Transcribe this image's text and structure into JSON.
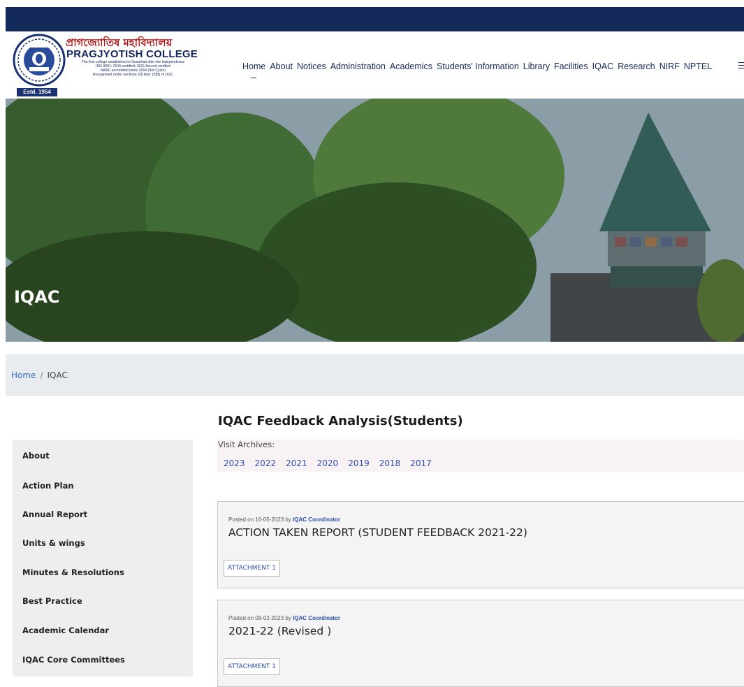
{
  "header": {
    "logo": {
      "bengali_name": "প্রাগজ্যোতিষ মহাবিদ্যালয়",
      "english_name": "PRAGJYOTISH COLLEGE",
      "tagline_lines": [
        "The first college established in Guwahati after the independence",
        "ISO 9001: 2015 certified; SDG Accord certified",
        "NAAC accredited since 2004 (3rd Cycle)",
        "Recognised under sections 2(f) And 12(B) of UGC"
      ],
      "estd": "Estd. 1954"
    },
    "nav": [
      "Home",
      "About",
      "Notices",
      "Administration",
      "Academics",
      "Students' Information",
      "Library",
      "Facilities",
      "IQAC",
      "Research",
      "NIRF",
      "NPTEL"
    ],
    "nav_extra_mark": "_",
    "menu_icon": "hamburger-icon",
    "brand_color": "#13295a"
  },
  "hero": {
    "title": "IQAC"
  },
  "breadcrumb": {
    "home": "Home",
    "separator": "/",
    "current": "IQAC"
  },
  "sidebar": {
    "items": [
      "About",
      "Action Plan",
      "Annual Report",
      "Units & wings",
      "Minutes & Resolutions",
      "Best Practice",
      "Academic Calendar",
      "IQAC Core Committees"
    ]
  },
  "main": {
    "heading": "IQAC Feedback Analysis(Students)",
    "archives": {
      "label": "Visit Archives:",
      "years": [
        "2023",
        "2022",
        "2021",
        "2020",
        "2019",
        "2018",
        "2017"
      ]
    },
    "posts": [
      {
        "posted_prefix": "Posted on 16-05-2023 by ",
        "author": "IQAC Coordinator",
        "title": "ACTION TAKEN REPORT (STUDENT FEEDBACK 2021-22)",
        "attachment": "ATTACHMENT 1"
      },
      {
        "posted_prefix": "Posted on 08-02-2023 by ",
        "author": "IQAC Coordinator",
        "title": "2021-22 (Revised )",
        "attachment": "ATTACHMENT 1"
      }
    ]
  }
}
